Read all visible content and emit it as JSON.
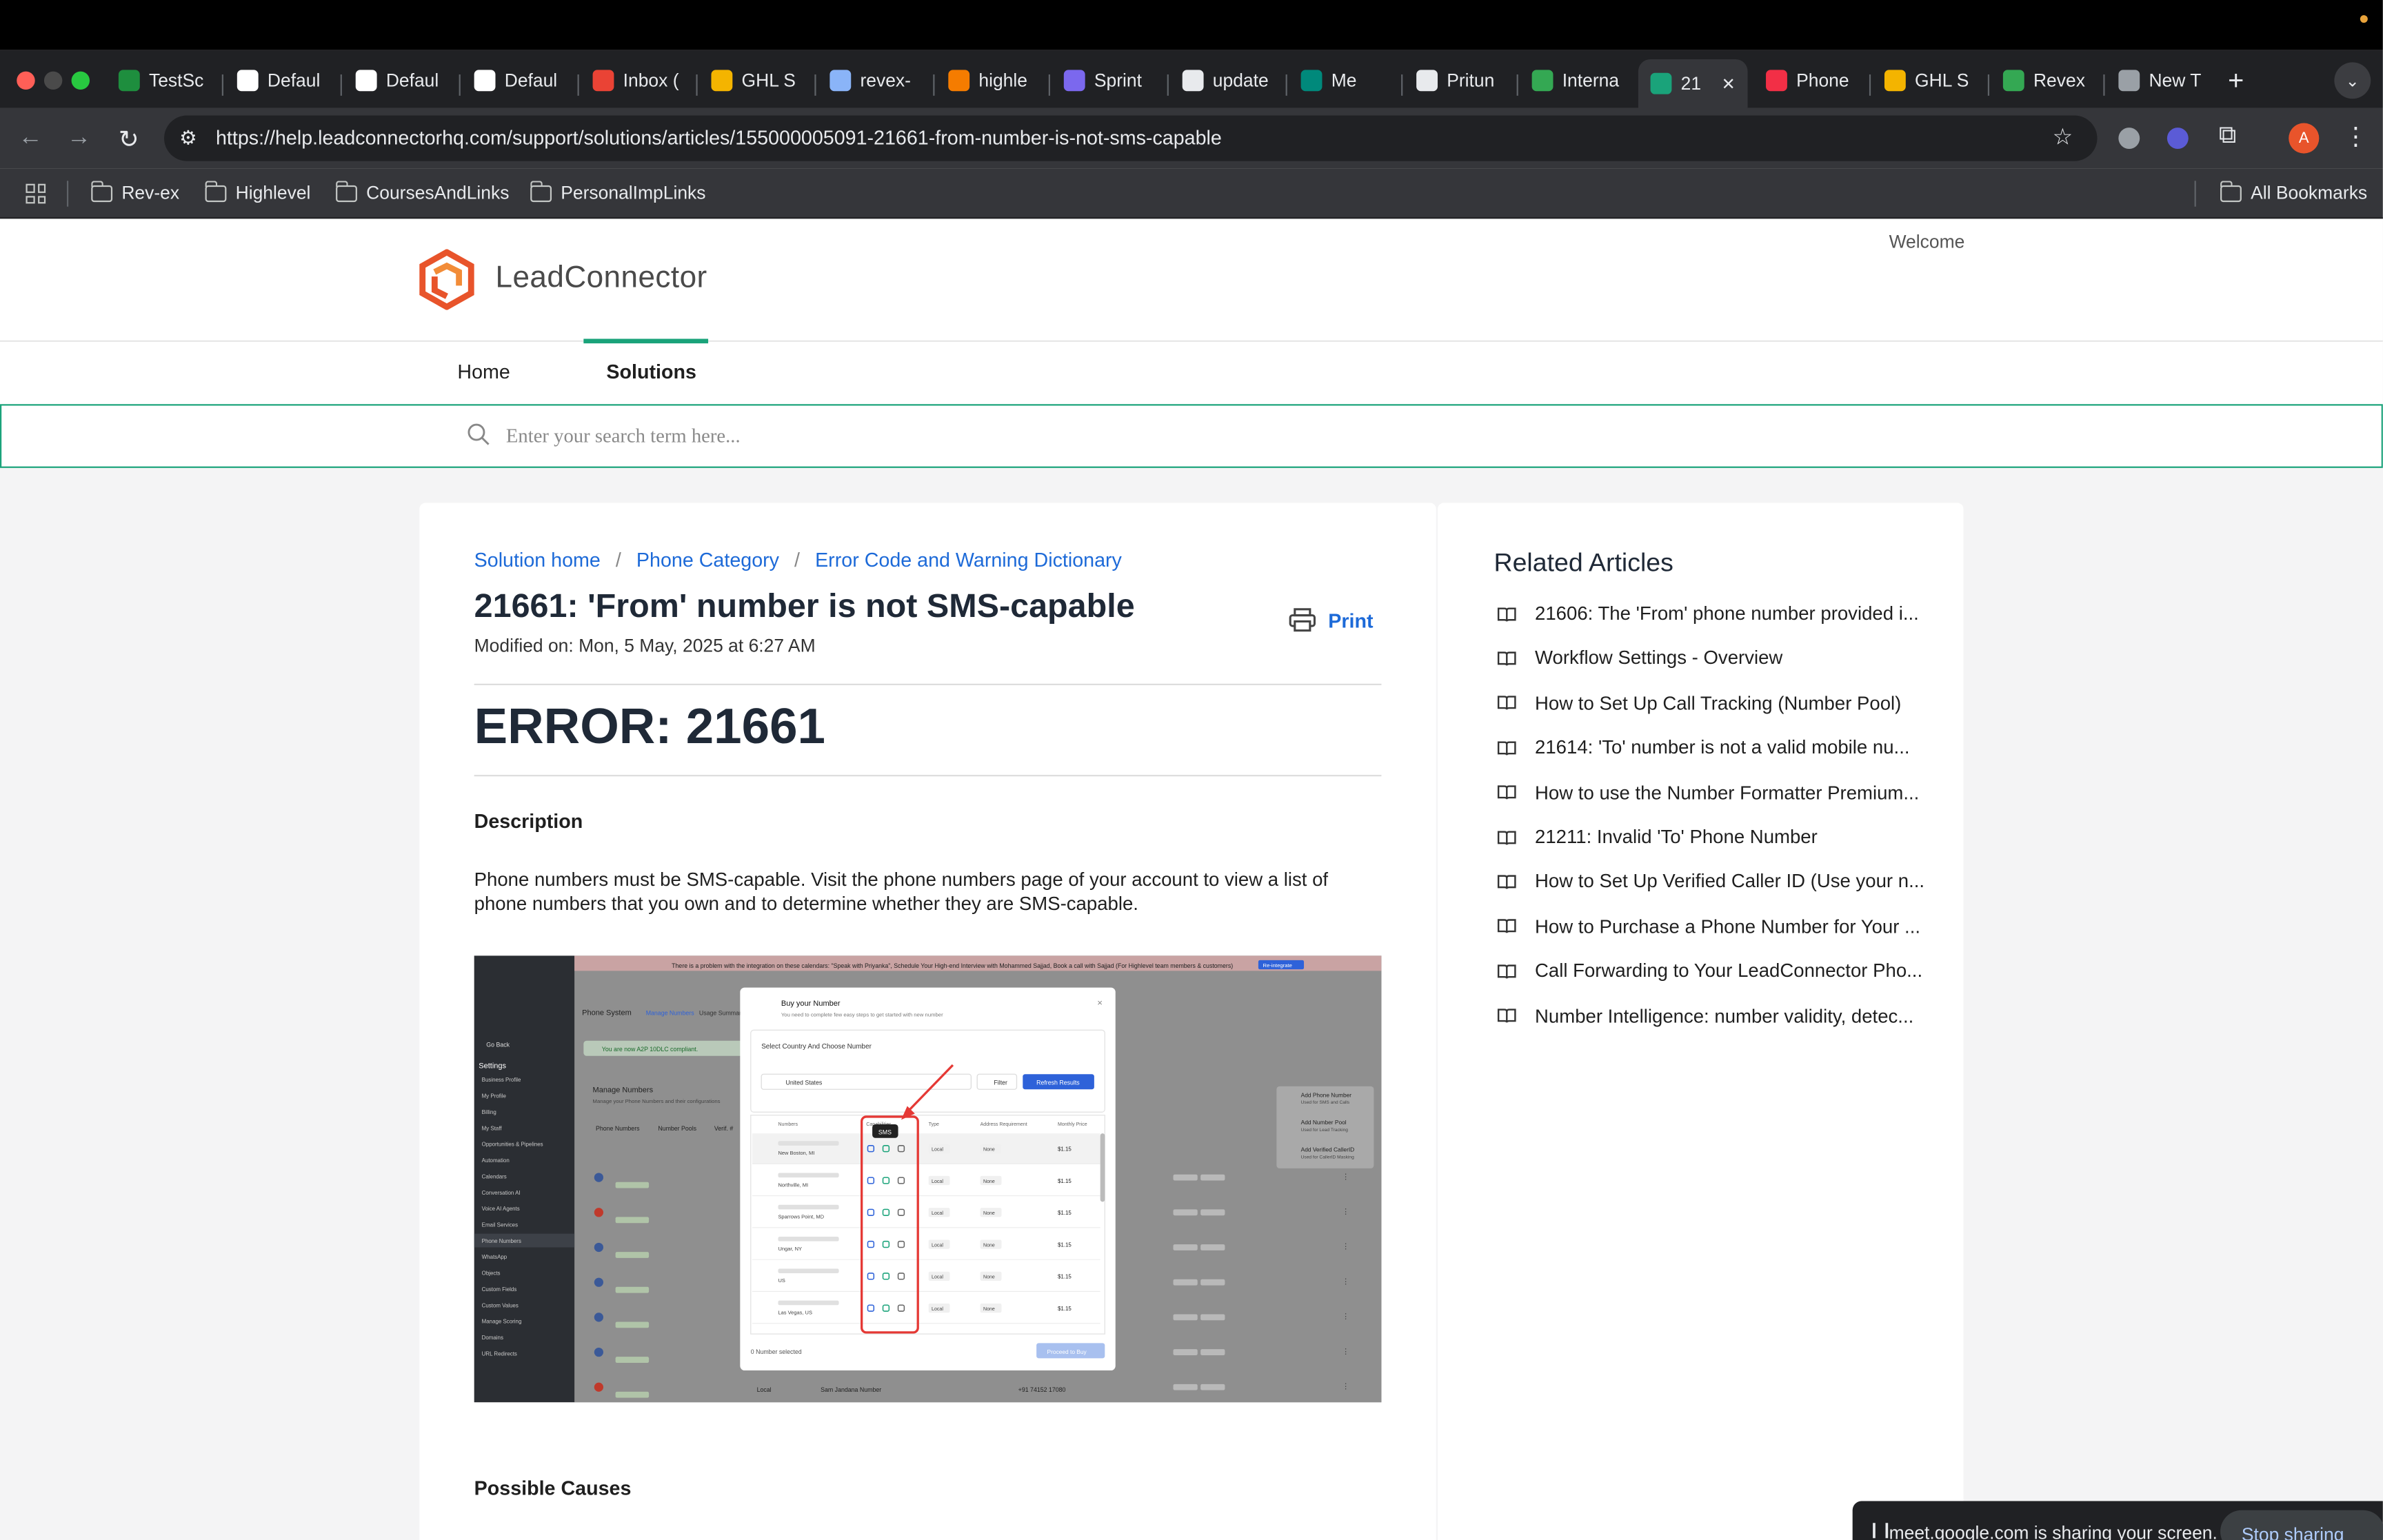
{
  "browser": {
    "tabs": [
      {
        "label": "TestSc",
        "favicon": "sheets-icon",
        "color": "#1e8e3e"
      },
      {
        "label": "Defaul",
        "favicon": "doc-icon",
        "color": "#ffffff"
      },
      {
        "label": "Defaul",
        "favicon": "doc-icon",
        "color": "#ffffff"
      },
      {
        "label": "Defaul",
        "favicon": "doc-icon",
        "color": "#ffffff"
      },
      {
        "label": "Inbox (",
        "favicon": "gmail-icon",
        "color": "#ea4335"
      },
      {
        "label": "GHL S",
        "favicon": "ghl-icon",
        "color": "#f4b400"
      },
      {
        "label": "revex-",
        "favicon": "revex-icon",
        "color": "#8ab4f8"
      },
      {
        "label": "highle",
        "favicon": "firebase-icon",
        "color": "#f57c00"
      },
      {
        "label": "Sprint",
        "favicon": "clickup-icon",
        "color": "#7b68ee"
      },
      {
        "label": "update",
        "favicon": "github-icon",
        "color": "#e8eaed"
      },
      {
        "label": "Me",
        "favicon": "meet-icon",
        "color": "#00897b"
      },
      {
        "label": "Pritun",
        "favicon": "pritunl-icon",
        "color": "#e8eaed"
      },
      {
        "label": "Interna",
        "favicon": "internal-icon",
        "color": "#34a853"
      },
      {
        "label": "21",
        "favicon": "leadconnector-icon",
        "color": "#1aa37a",
        "active": true
      },
      {
        "label": "Phone",
        "favicon": "twilio-icon",
        "color": "#f22f46"
      },
      {
        "label": "GHL S",
        "favicon": "ghl-icon",
        "color": "#f4b400"
      },
      {
        "label": "Revex",
        "favicon": "revex-chart-icon",
        "color": "#34a853"
      },
      {
        "label": "New T",
        "favicon": "chrome-icon",
        "color": "#9aa0a6"
      }
    ],
    "url": "https://help.leadconnectorhq.com/support/solutions/articles/155000005091-21661-from-number-is-not-sms-capable",
    "profile_initial": "A",
    "bookmarks": [
      "Rev-ex",
      "Highlevel",
      "CoursesAndLinks",
      "PersonalImpLinks"
    ],
    "all_bookmarks": "All Bookmarks"
  },
  "site": {
    "brand": "LeadConnector",
    "welcome": "Welcome",
    "nav": {
      "home": "Home",
      "solutions": "Solutions"
    },
    "search_placeholder": "Enter your search term here...",
    "accent": "#1aa37a",
    "link_color": "#1d6ad8"
  },
  "article": {
    "breadcrumbs": [
      "Solution home",
      "Phone Category",
      "Error Code and Warning Dictionary"
    ],
    "title": "21661: 'From' number is not SMS-capable",
    "modified": "Modified on: Mon, 5 May, 2025 at 6:27 AM",
    "print": "Print",
    "error_heading": "ERROR: 21661",
    "description_heading": "Description",
    "description": "Phone numbers must be SMS-capable. Visit the phone numbers page of your account to view a list of phone numbers that you own and to determine whether they are SMS-capable.",
    "possible_causes_heading": "Possible Causes"
  },
  "screenshot": {
    "banner": "There is a problem with the integration on these calendars: \"Speak with Priyanka\", Schedule Your High-end Interview with Mohammed Sajjad, Book a call with Sajjad (For Highlevel team members & customers)",
    "banner_btn": "Re-integrate",
    "go_back": "Go Back",
    "settings": "Settings",
    "menu": [
      "Business Profile",
      "My Profile",
      "Billing",
      "My Staff",
      "Opportunities & Pipelines",
      "Automation",
      "Calendars",
      "Conversation AI",
      "Voice AI Agents",
      "Email Services",
      "Phone Numbers",
      "WhatsApp",
      "Objects",
      "Custom Fields",
      "Custom Values",
      "Manage Scoring",
      "Domains",
      "URL Redirects"
    ],
    "page_title": "Phone System",
    "tabs": [
      "Manage Numbers",
      "Usage Summary"
    ],
    "a2p": "You are now A2P 10DLC compliant.",
    "manage_numbers": "Manage Numbers",
    "manage_sub": "Manage your Phone Numbers and their configurations",
    "subtabs": [
      "Phone Numbers",
      "Number Pools",
      "Verif. #"
    ],
    "add_menu": [
      {
        "title": "Add Phone Number",
        "sub": "Used for SMS and Calls"
      },
      {
        "title": "Add Number Pool",
        "sub": "Used for Lead Tracking"
      },
      {
        "title": "Add Verified CallerID",
        "sub": "Used for CallerID Masking"
      }
    ],
    "modal": {
      "title": "Buy your Number",
      "subtitle": "You need to complete few easy steps to get started with new number",
      "section": "Select Country And Choose Number",
      "country": "United States",
      "filter": "Filter",
      "refresh": "Refresh Results",
      "columns": [
        "Numbers",
        "Capabilities",
        "Type",
        "Address Requirement",
        "Monthly Price"
      ],
      "tooltip": "SMS",
      "rows": [
        {
          "loc": "New Boston, MI",
          "type": "Local",
          "addr": "None",
          "price": "$1.15"
        },
        {
          "loc": "Northville, MI",
          "type": "Local",
          "addr": "None",
          "price": "$1.15"
        },
        {
          "loc": "Sparrows Point, MD",
          "type": "Local",
          "addr": "None",
          "price": "$1.15"
        },
        {
          "loc": "Ungar, NY",
          "type": "Local",
          "addr": "None",
          "price": "$1.15"
        },
        {
          "loc": "US",
          "type": "Local",
          "addr": "None",
          "price": "$1.15"
        },
        {
          "loc": "Las Vegas, US",
          "type": "Local",
          "addr": "None",
          "price": "$1.15"
        }
      ],
      "selected": "0 Number selected",
      "proceed": "Proceed to Buy"
    },
    "bottom_row": {
      "type": "Local",
      "name": "Sam Jandana Number",
      "phone": "+91 74152 17080"
    }
  },
  "related": {
    "heading": "Related Articles",
    "items": [
      "21606: The 'From' phone number provided i...",
      "Workflow Settings - Overview",
      "How to Set Up Call Tracking (Number Pool)",
      "21614: 'To' number is not a valid mobile nu...",
      "How to use the Number Formatter Premium...",
      "21211: Invalid 'To' Phone Number",
      "How to Set Up Verified Caller ID (Use your n...",
      "How to Purchase a Phone Number for Your ...",
      "Call Forwarding to Your LeadConnector Pho...",
      "Number Intelligence: number validity, detec..."
    ]
  },
  "share_bar": {
    "message": "meet.google.com is sharing your screen.",
    "stop": "Stop sharing"
  }
}
